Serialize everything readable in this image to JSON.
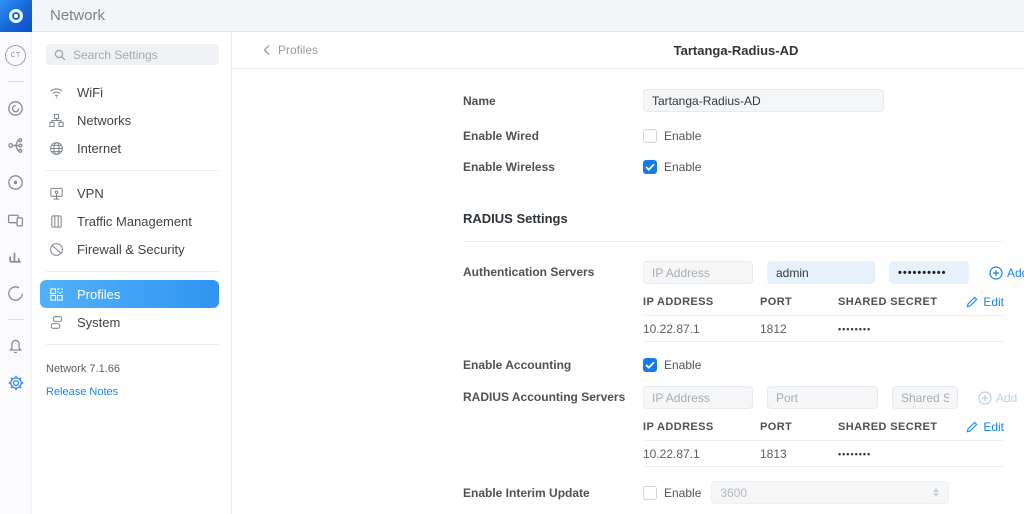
{
  "app": {
    "title": "Network"
  },
  "colors": {
    "accent_blue": "#1285f2",
    "active_item_gradient": [
      "#53b1f9",
      "#2f95f2"
    ],
    "checked_checkbox": "#137bec",
    "topbar_bg": "#f4f5f6",
    "filled_input_bg": "#e7f1fc"
  },
  "rail": {
    "avatar_initials": "CT",
    "icons": [
      "avatar",
      "dashboard-dial-icon",
      "topology-icon",
      "radios-icon",
      "clients-icon",
      "statistics-icon",
      "insights-icon",
      "bell-icon",
      "gear-icon"
    ]
  },
  "sidebar": {
    "search_placeholder": "Search Settings",
    "items": [
      {
        "label": "WiFi",
        "icon": "wifi-icon"
      },
      {
        "label": "Networks",
        "icon": "networks-icon"
      },
      {
        "label": "Internet",
        "icon": "globe-icon"
      },
      {
        "label": "VPN",
        "icon": "vpn-icon"
      },
      {
        "label": "Traffic Management",
        "icon": "traffic-icon"
      },
      {
        "label": "Firewall & Security",
        "icon": "firewall-icon"
      },
      {
        "label": "Profiles",
        "icon": "profiles-icon",
        "active": true
      },
      {
        "label": "System",
        "icon": "system-icon"
      }
    ],
    "version": "Network 7.1.66",
    "release_notes": "Release Notes"
  },
  "header": {
    "back": "Profiles",
    "title": "Tartanga-Radius-AD"
  },
  "form": {
    "name": {
      "label": "Name",
      "value": "Tartanga-Radius-AD"
    },
    "wired": {
      "label": "Enable Wired",
      "checkbox_label": "Enable",
      "checked": false
    },
    "wireless": {
      "label": "Enable Wireless",
      "checkbox_label": "Enable",
      "checked": true
    },
    "radius_heading": "RADIUS Settings",
    "auth": {
      "label": "Authentication Servers",
      "ip_placeholder": "IP Address",
      "username_value": "admin",
      "password_value": "••••••••••",
      "add_label": "Add",
      "table": {
        "headers": [
          "IP ADDRESS",
          "PORT",
          "SHARED SECRET"
        ],
        "edit_label": "Edit",
        "rows": [
          [
            "10.22.87.1",
            "1812",
            "••••••••"
          ]
        ]
      }
    },
    "accounting_toggle": {
      "label": "Enable Accounting",
      "checkbox_label": "Enable",
      "checked": true
    },
    "accounting": {
      "label": "RADIUS Accounting Servers",
      "ip_placeholder": "IP Address",
      "port_placeholder": "Port",
      "secret_placeholder": "Shared Secret",
      "add_label": "Add",
      "add_disabled": true,
      "table": {
        "headers": [
          "IP ADDRESS",
          "PORT",
          "SHARED SECRET"
        ],
        "edit_label": "Edit",
        "rows": [
          [
            "10.22.87.1",
            "1813",
            "••••••••"
          ]
        ]
      }
    },
    "interim": {
      "label": "Enable Interim Update",
      "checkbox_label": "Enable",
      "value": "3600",
      "checked": false
    }
  }
}
